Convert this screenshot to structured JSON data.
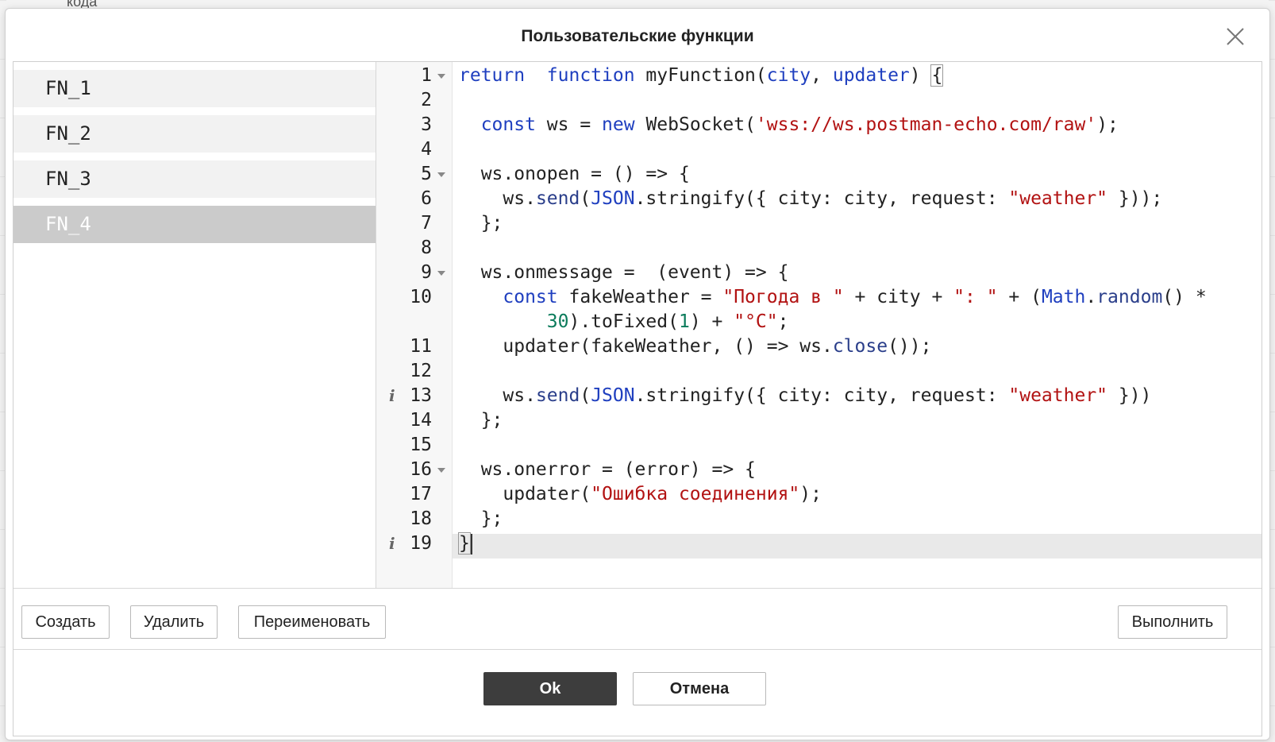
{
  "background": {
    "peek_text": "кода"
  },
  "dialog": {
    "title": "Пользовательские функции",
    "functions": [
      "FN_1",
      "FN_2",
      "FN_3",
      "FN_4"
    ],
    "selected_function": "FN_4",
    "editor": {
      "lines": [
        {
          "n": "1",
          "fold": true,
          "info": false,
          "tokens": [
            [
              "kw",
              "return"
            ],
            [
              "",
              "  "
            ],
            [
              "kw",
              "function"
            ],
            [
              "",
              " myFunction("
            ],
            [
              "kw",
              "city"
            ],
            [
              "",
              ", "
            ],
            [
              "kw",
              "updater"
            ],
            [
              "",
              ") "
            ],
            [
              "bracket",
              "{"
            ]
          ]
        },
        {
          "n": "2",
          "fold": false,
          "info": false,
          "tokens": []
        },
        {
          "n": "3",
          "fold": false,
          "info": false,
          "tokens": [
            [
              "",
              "  "
            ],
            [
              "kw",
              "const"
            ],
            [
              "",
              " ws = "
            ],
            [
              "kw",
              "new"
            ],
            [
              "",
              " WebSocket("
            ],
            [
              "str",
              "'wss://ws.postman-echo.com/raw'"
            ],
            [
              "",
              ");"
            ]
          ]
        },
        {
          "n": "4",
          "fold": false,
          "info": false,
          "tokens": []
        },
        {
          "n": "5",
          "fold": true,
          "info": false,
          "tokens": [
            [
              "",
              "  ws.onopen = () => {"
            ]
          ]
        },
        {
          "n": "6",
          "fold": false,
          "info": false,
          "tokens": [
            [
              "",
              "    ws."
            ],
            [
              "meth",
              "send"
            ],
            [
              "",
              "("
            ],
            [
              "bi",
              "JSON"
            ],
            [
              "",
              ".stringify({ city: city, request: "
            ],
            [
              "str",
              "\"weather\""
            ],
            [
              "",
              " }));"
            ]
          ]
        },
        {
          "n": "7",
          "fold": false,
          "info": false,
          "tokens": [
            [
              "",
              "  };"
            ]
          ]
        },
        {
          "n": "8",
          "fold": false,
          "info": false,
          "tokens": []
        },
        {
          "n": "9",
          "fold": true,
          "info": false,
          "tokens": [
            [
              "",
              "  ws.onmessage =  (event) => {"
            ]
          ]
        },
        {
          "n": "10",
          "fold": false,
          "info": false,
          "tokens": [
            [
              "",
              "    "
            ],
            [
              "kw",
              "const"
            ],
            [
              "",
              " fakeWeather = "
            ],
            [
              "str",
              "\"Погода в \""
            ],
            [
              "",
              " + city + "
            ],
            [
              "str",
              "\": \""
            ],
            [
              "",
              " + ("
            ],
            [
              "bi",
              "Math"
            ],
            [
              "",
              "."
            ],
            [
              "meth",
              "random"
            ],
            [
              "",
              "() *"
            ]
          ]
        },
        {
          "n": "",
          "fold": false,
          "info": false,
          "tokens": [
            [
              "",
              "        "
            ],
            [
              "num",
              "30"
            ],
            [
              "",
              ").toFixed("
            ],
            [
              "num",
              "1"
            ],
            [
              "",
              ") + "
            ],
            [
              "str",
              "\"°C\""
            ],
            [
              "",
              ";"
            ]
          ]
        },
        {
          "n": "11",
          "fold": false,
          "info": false,
          "tokens": [
            [
              "",
              "    updater(fakeWeather, () => ws."
            ],
            [
              "meth",
              "close"
            ],
            [
              "",
              "());"
            ]
          ]
        },
        {
          "n": "12",
          "fold": false,
          "info": false,
          "tokens": []
        },
        {
          "n": "13",
          "fold": false,
          "info": true,
          "tokens": [
            [
              "",
              "    ws."
            ],
            [
              "meth",
              "send"
            ],
            [
              "",
              "("
            ],
            [
              "bi",
              "JSON"
            ],
            [
              "",
              ".stringify({ city: city, request: "
            ],
            [
              "str",
              "\"weather\""
            ],
            [
              "",
              " }))"
            ]
          ]
        },
        {
          "n": "14",
          "fold": false,
          "info": false,
          "tokens": [
            [
              "",
              "  };"
            ]
          ]
        },
        {
          "n": "15",
          "fold": false,
          "info": false,
          "tokens": []
        },
        {
          "n": "16",
          "fold": true,
          "info": false,
          "tokens": [
            [
              "",
              "  ws.onerror = (error) => {"
            ]
          ]
        },
        {
          "n": "17",
          "fold": false,
          "info": false,
          "tokens": [
            [
              "",
              "    updater("
            ],
            [
              "str",
              "\"Ошибка соединения\""
            ],
            [
              "",
              ");"
            ]
          ]
        },
        {
          "n": "18",
          "fold": false,
          "info": false,
          "tokens": [
            [
              "",
              "  };"
            ]
          ]
        },
        {
          "n": "19",
          "fold": false,
          "info": true,
          "tokens": [
            [
              "bracket",
              "}"
            ],
            [
              "cursor",
              ""
            ]
          ]
        }
      ]
    },
    "toolbar": {
      "create_label": "Создать",
      "delete_label": "Удалить",
      "rename_label": "Переименовать",
      "run_label": "Выполнить"
    },
    "footer": {
      "ok_label": "Ok",
      "cancel_label": "Отмена"
    }
  },
  "icons": {
    "close": "close-icon",
    "fold": "fold-arrow-icon",
    "info": "info-icon"
  },
  "colors": {
    "ok_bg": "#3d3d3d",
    "selected_item_bg": "#cbcbcb",
    "keyword": "#1f3fbf",
    "string": "#b21212",
    "number": "#0b7b5b"
  }
}
